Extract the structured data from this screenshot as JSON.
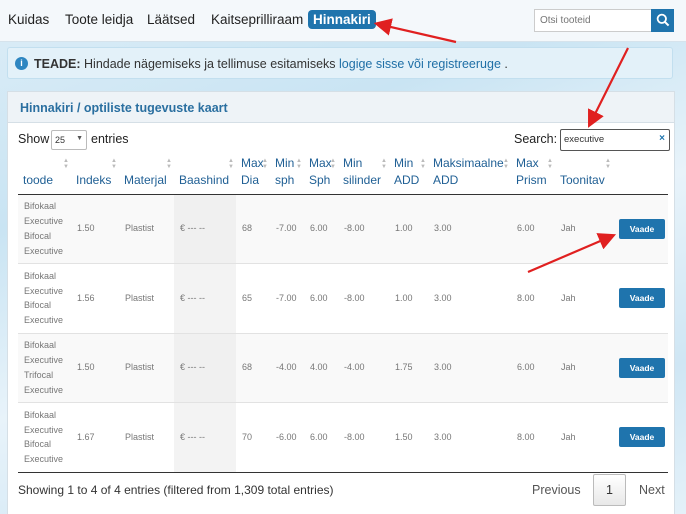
{
  "nav": {
    "items": [
      "Kuidas",
      "Toote leidja",
      "Läätsed",
      "Kaitseprilliraam",
      "Hinnakiri"
    ],
    "search_placeholder": "Otsi tooteid"
  },
  "notice": {
    "bold": "TEADE:",
    "text": "Hindade nägemiseks ja tellimuse esitamiseks",
    "link": "logige sisse või registreeruge",
    "tail": "."
  },
  "panel": {
    "title": "Hinnakiri / optiliste tugevuste kaart",
    "show_label": "Show",
    "show_value": "25",
    "entries_label": "entries",
    "search_label": "Search:",
    "search_value": "executive"
  },
  "table": {
    "columns": [
      "toode",
      "Indeks",
      "Materjal",
      "Baashind",
      "Max Dia",
      "Min sph",
      "Max Sph",
      "Min silinder",
      "Min ADD",
      "Maksimaalne ADD",
      "Max Prism",
      "Toonitav",
      ""
    ],
    "rows": [
      {
        "toode": "Bifokaal Executive Bifocal Executive",
        "indeks": "1.50",
        "materjal": "Plastist",
        "baashind": "€ --- --",
        "max_dia": "68",
        "min_sph": "-7.00",
        "max_sph": "6.00",
        "min_silinder": "-8.00",
        "min_add": "1.00",
        "max_add": "3.00",
        "max_prism": "6.00",
        "toonitav": "Jah",
        "action": "Vaade"
      },
      {
        "toode": "Bifokaal Executive Bifocal Executive",
        "indeks": "1.56",
        "materjal": "Plastist",
        "baashind": "€ --- --",
        "max_dia": "65",
        "min_sph": "-7.00",
        "max_sph": "6.00",
        "min_silinder": "-8.00",
        "min_add": "1.00",
        "max_add": "3.00",
        "max_prism": "8.00",
        "toonitav": "Jah",
        "action": "Vaade"
      },
      {
        "toode": "Bifokaal Executive Trifocal Executive",
        "indeks": "1.50",
        "materjal": "Plastist",
        "baashind": "€ --- --",
        "max_dia": "68",
        "min_sph": "-4.00",
        "max_sph": "4.00",
        "min_silinder": "-4.00",
        "min_add": "1.75",
        "max_add": "3.00",
        "max_prism": "6.00",
        "toonitav": "Jah",
        "action": "Vaade"
      },
      {
        "toode": "Bifokaal Executive Bifocal Executive",
        "indeks": "1.67",
        "materjal": "Plastist",
        "baashind": "€ --- --",
        "max_dia": "70",
        "min_sph": "-6.00",
        "max_sph": "6.00",
        "min_silinder": "-8.00",
        "min_add": "1.50",
        "max_add": "3.00",
        "max_prism": "8.00",
        "toonitav": "Jah",
        "action": "Vaade"
      }
    ]
  },
  "footer": {
    "info": "Showing 1 to 4 of 4 entries (filtered from 1,309 total entries)",
    "prev": "Previous",
    "page": "1",
    "next": "Next"
  },
  "colors": {
    "accent": "#1f74ad",
    "annotation": "#e02020"
  }
}
